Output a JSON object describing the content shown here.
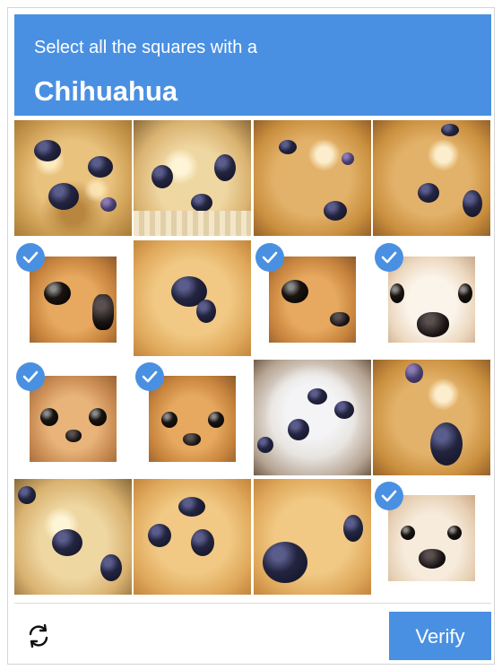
{
  "header": {
    "instruction": "Select all the squares with a",
    "keyword": "Chihuahua",
    "background_color": "#4a90e2"
  },
  "grid": {
    "rows": 4,
    "columns": 4,
    "tiles": [
      {
        "index": 0,
        "subject": "blueberry muffin",
        "selected": false
      },
      {
        "index": 1,
        "subject": "blueberry muffin",
        "selected": false
      },
      {
        "index": 2,
        "subject": "blueberry muffin",
        "selected": false
      },
      {
        "index": 3,
        "subject": "blueberry muffin",
        "selected": false
      },
      {
        "index": 4,
        "subject": "chihuahua",
        "selected": true
      },
      {
        "index": 5,
        "subject": "blueberry muffin",
        "selected": false
      },
      {
        "index": 6,
        "subject": "chihuahua",
        "selected": true
      },
      {
        "index": 7,
        "subject": "chihuahua",
        "selected": true
      },
      {
        "index": 8,
        "subject": "chihuahua",
        "selected": true
      },
      {
        "index": 9,
        "subject": "chihuahua",
        "selected": true
      },
      {
        "index": 10,
        "subject": "blueberry muffin",
        "selected": false
      },
      {
        "index": 11,
        "subject": "blueberry muffin",
        "selected": false
      },
      {
        "index": 12,
        "subject": "blueberry muffin",
        "selected": false
      },
      {
        "index": 13,
        "subject": "blueberry muffin",
        "selected": false
      },
      {
        "index": 14,
        "subject": "blueberry muffin",
        "selected": false
      },
      {
        "index": 15,
        "subject": "chihuahua",
        "selected": true
      }
    ]
  },
  "icons": {
    "selected_marker": "check-circle-icon",
    "reload": "reload-icon"
  },
  "footer": {
    "verify_label": "Verify",
    "accent_color": "#4a90e2"
  }
}
